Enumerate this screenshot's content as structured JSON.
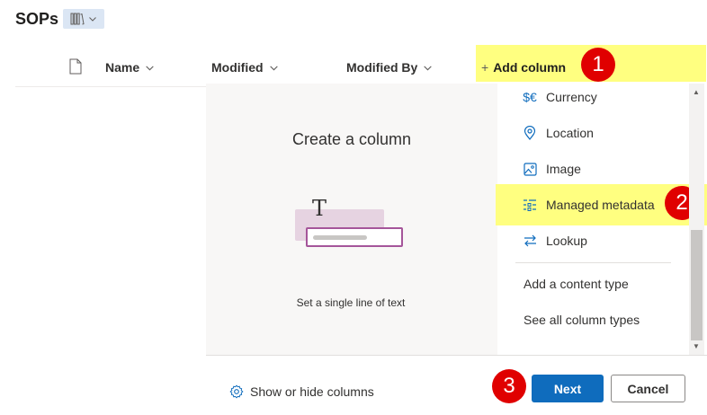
{
  "page": {
    "title": "SOPs"
  },
  "columns": {
    "name": "Name",
    "modified": "Modified",
    "modified_by": "Modified By"
  },
  "add_column": {
    "label": "Add column",
    "plus": "+"
  },
  "panel": {
    "heading": "Create a column",
    "preview_glyph": "T",
    "description": "Set a single line of text"
  },
  "menu": {
    "currency": "Currency",
    "location": "Location",
    "image": "Image",
    "managed_metadata": "Managed metadata",
    "lookup": "Lookup",
    "content_type": "Add a content type",
    "see_all": "See all column types"
  },
  "scroll": {
    "up": "▲",
    "down": "▼"
  },
  "footer": {
    "show_hide": "Show or hide columns",
    "next": "Next",
    "cancel": "Cancel"
  },
  "badges": {
    "b1": "1",
    "b2": "2",
    "b3": "3"
  },
  "colors": {
    "highlight": "#ffff80",
    "badge": "#e00000",
    "primary": "#0f6cbd"
  }
}
